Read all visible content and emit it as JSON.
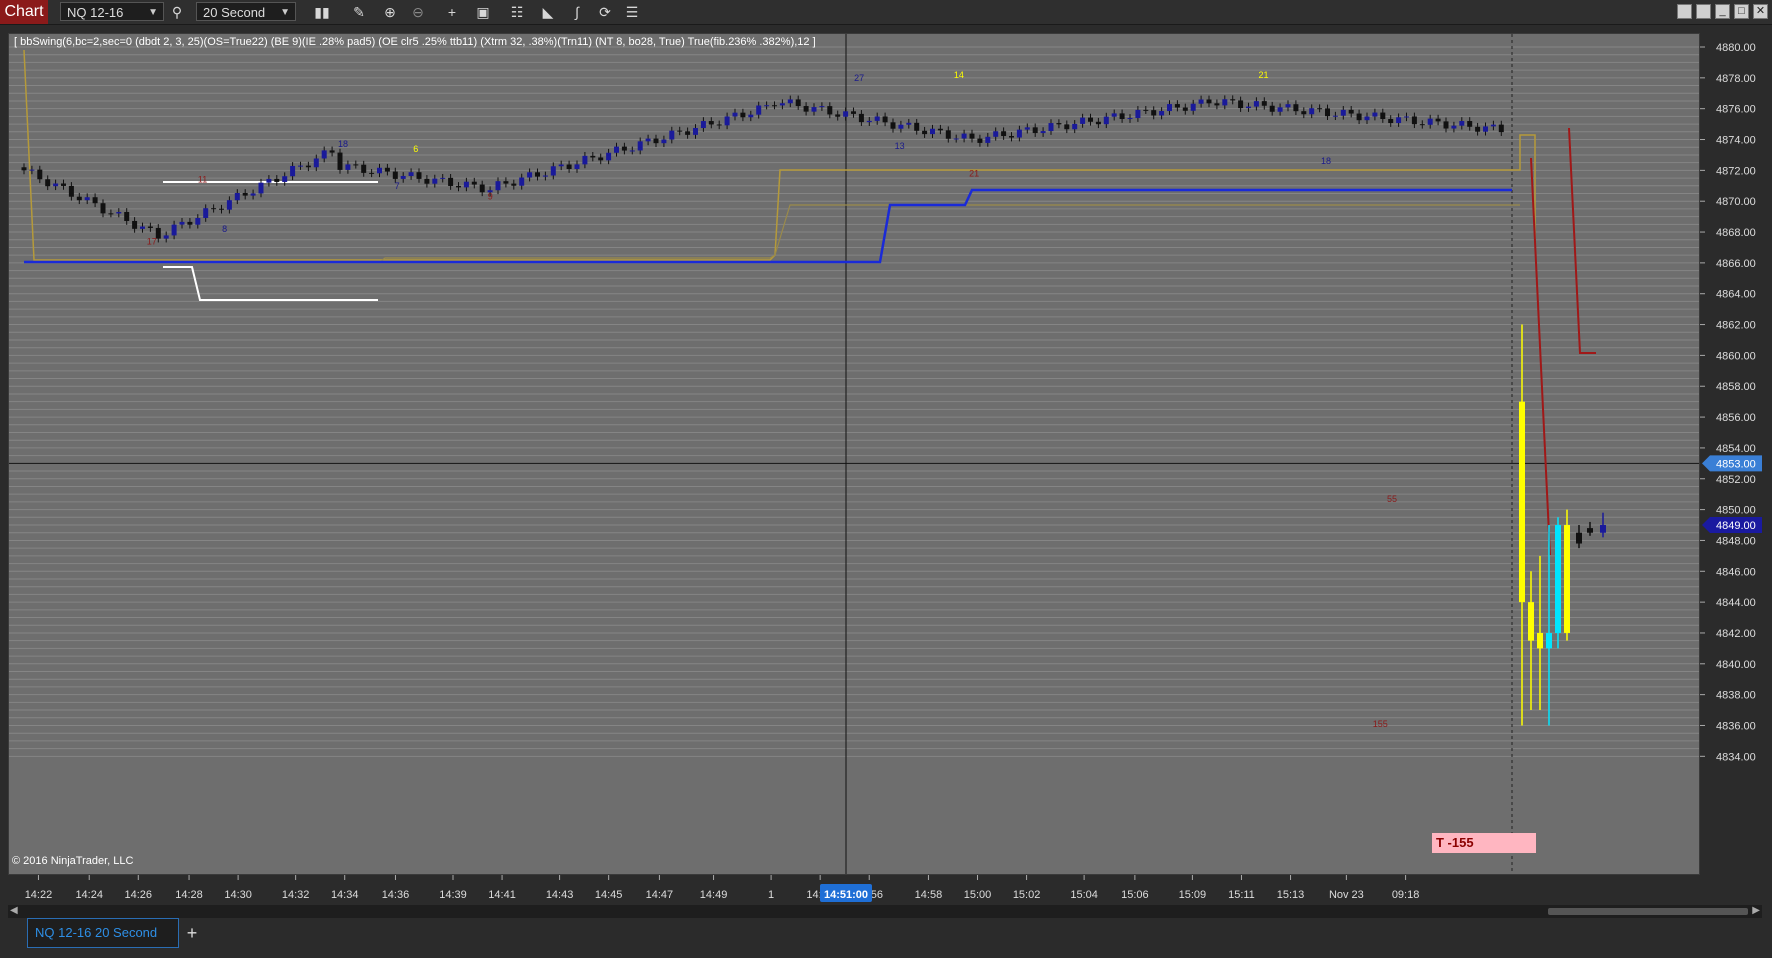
{
  "toolbar": {
    "title": "Chart",
    "instrument": "NQ 12-16",
    "interval": "20 Second"
  },
  "icons": [
    "search-icon",
    "bar-type-icon",
    "draw-pencil-icon",
    "zoom-in-icon",
    "zoom-out-icon",
    "crosshair-icon",
    "data-box-icon",
    "strategy-icon",
    "shapes-icon",
    "indicators-icon",
    "reload-icon",
    "properties-icon"
  ],
  "chart_data": {
    "type": "candlestick",
    "indicator_label": "[ bbSwing(6,bc=2,sec=0 (dbdt 2, 3, 25)(OS=True22) (BE 9)(IE .28% pad5) (OE clr5 .25% ttb11) (Xtrm 32, .38%)(Trn11) (NT 8, bo28, True) True(fib.236% .382%),12 ]",
    "copyright": "© 2016 NinjaTrader, LLC",
    "y_ticks": [
      "4880.00",
      "4878.00",
      "4876.00",
      "4874.00",
      "4872.00",
      "4870.00",
      "4868.00",
      "4866.00",
      "4864.00",
      "4862.00",
      "4860.00",
      "4858.00",
      "4856.00",
      "4854.00",
      "4852.00",
      "4850.00",
      "4848.00",
      "4846.00",
      "4844.00",
      "4842.00",
      "4840.00",
      "4838.00",
      "4836.00",
      "4834.00"
    ],
    "x_ticks": [
      "14:22",
      "14:24",
      "14:26",
      "14:28",
      "14:30",
      "14:32",
      "14:34",
      "14:36",
      "14:39",
      "14:41",
      "14:43",
      "14:45",
      "14:47",
      "14:49",
      "1",
      "14:54",
      "14:56",
      "14:58",
      "15:00",
      "15:02",
      "15:04",
      "15:06",
      "15:09",
      "15:11",
      "15:13",
      "Nov 23",
      "09:18"
    ],
    "crosshair_time": "14:51:00",
    "crosshair_price": "4853.00",
    "last_price": "4849.00",
    "swing_labels": [
      {
        "text": "17",
        "price": 4867.2,
        "x": 0.085,
        "color": "#8b1a1a"
      },
      {
        "text": "11",
        "price": 4871.2,
        "x": 0.115,
        "color": "#8b1a1a"
      },
      {
        "text": "8",
        "price": 4868.0,
        "x": 0.128,
        "color": "#1a1a8b"
      },
      {
        "text": "18",
        "price": 4873.5,
        "x": 0.198,
        "color": "#1a1a8b"
      },
      {
        "text": "6",
        "price": 4873.2,
        "x": 0.241,
        "color": "#ffff00"
      },
      {
        "text": "7",
        "price": 4870.8,
        "x": 0.23,
        "color": "#1a1a8b"
      },
      {
        "text": "9",
        "price": 4870.1,
        "x": 0.285,
        "color": "#8b1a1a"
      },
      {
        "text": "27",
        "price": 4877.8,
        "x": 0.503,
        "color": "#1a1a8b"
      },
      {
        "text": "14",
        "price": 4878.0,
        "x": 0.562,
        "color": "#ffff00"
      },
      {
        "text": "13",
        "price": 4873.4,
        "x": 0.527,
        "color": "#1a1a8b"
      },
      {
        "text": "21",
        "price": 4871.6,
        "x": 0.571,
        "color": "#8b1a1a"
      },
      {
        "text": "21",
        "price": 4878.0,
        "x": 0.742,
        "color": "#ffff00"
      },
      {
        "text": "18",
        "price": 4872.4,
        "x": 0.779,
        "color": "#1a1a8b"
      },
      {
        "text": "55",
        "price": 4850.5,
        "x": 0.818,
        "color": "#8b1a1a"
      },
      {
        "text": "155",
        "price": 4835.9,
        "x": 0.811,
        "color": "#8b1a1a"
      }
    ],
    "trade_label": "T -155"
  },
  "tabs": {
    "active": "NQ 12-16 20 Second",
    "add": "+"
  }
}
